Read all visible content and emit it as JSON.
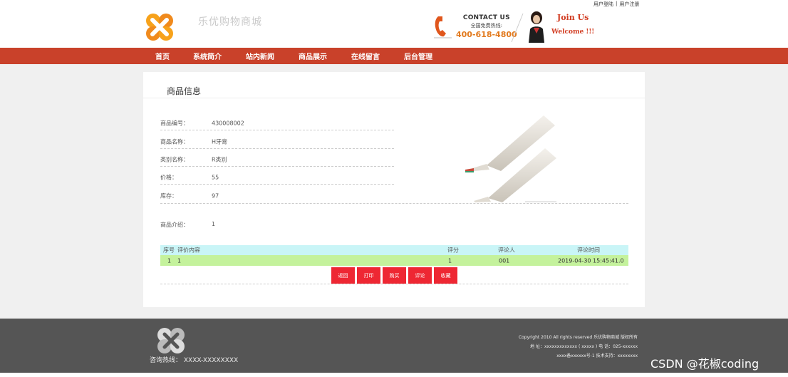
{
  "header": {
    "top_links": {
      "login": "用户登陆",
      "separator": "|",
      "register": "用户注册"
    },
    "site_title": "乐优购物商城",
    "contact": {
      "title": "CONTACT US",
      "subtitle": "全国免费热线:",
      "phone": "400-618-4800"
    },
    "join": {
      "line1": "Join Us",
      "line2": "Welcome !!!"
    }
  },
  "nav": {
    "items": [
      {
        "label": "首页"
      },
      {
        "label": "系统简介"
      },
      {
        "label": "站内新闻"
      },
      {
        "label": "商品展示"
      },
      {
        "label": "在线留言"
      },
      {
        "label": "后台管理"
      }
    ]
  },
  "product": {
    "section_title": "商品信息",
    "fields": [
      {
        "label": "商品编号：",
        "value": "430008002"
      },
      {
        "label": "商品名称：",
        "value": "H牙膏"
      },
      {
        "label": "类别名称：",
        "value": "R类别"
      },
      {
        "label": "价格：",
        "value": "55"
      },
      {
        "label": "库存：",
        "value": "97"
      }
    ],
    "intro_label": "商品介绍：",
    "intro_value": "1"
  },
  "reviews": {
    "headers": {
      "index": "序号",
      "content": "评价内容",
      "score": "评分",
      "reviewer": "评论人",
      "time": "评论时间"
    },
    "rows": [
      {
        "index": "1",
        "content": "1",
        "score": "1",
        "reviewer": "001",
        "time": "2019-04-30 15:45:41.0"
      }
    ]
  },
  "buttons": {
    "back": "返回",
    "print": "打印",
    "buy": "购买",
    "review": "评论",
    "favorite": "收藏"
  },
  "footer": {
    "hotline": "咨询热线： XXXX-XXXXXXXX",
    "copyright": "Copyright 2010 All rights reserved 乐优购物商城 版权所有",
    "address": "地 址：xxxxxxxxxxxxx ( xxxxx ) 电 话：025-xxxxxx",
    "icp": "xxxx备xxxxxx号-1 技术支持：xxxxxxxx"
  },
  "watermark": "CSDN @花椒coding",
  "colors": {
    "nav_red": "#c9412a",
    "button_red": "#ee2733",
    "table_head": "#c9f5f7",
    "table_row": "#c4f29c",
    "footer": "#555555",
    "logo_orange": "#f08a1d"
  }
}
